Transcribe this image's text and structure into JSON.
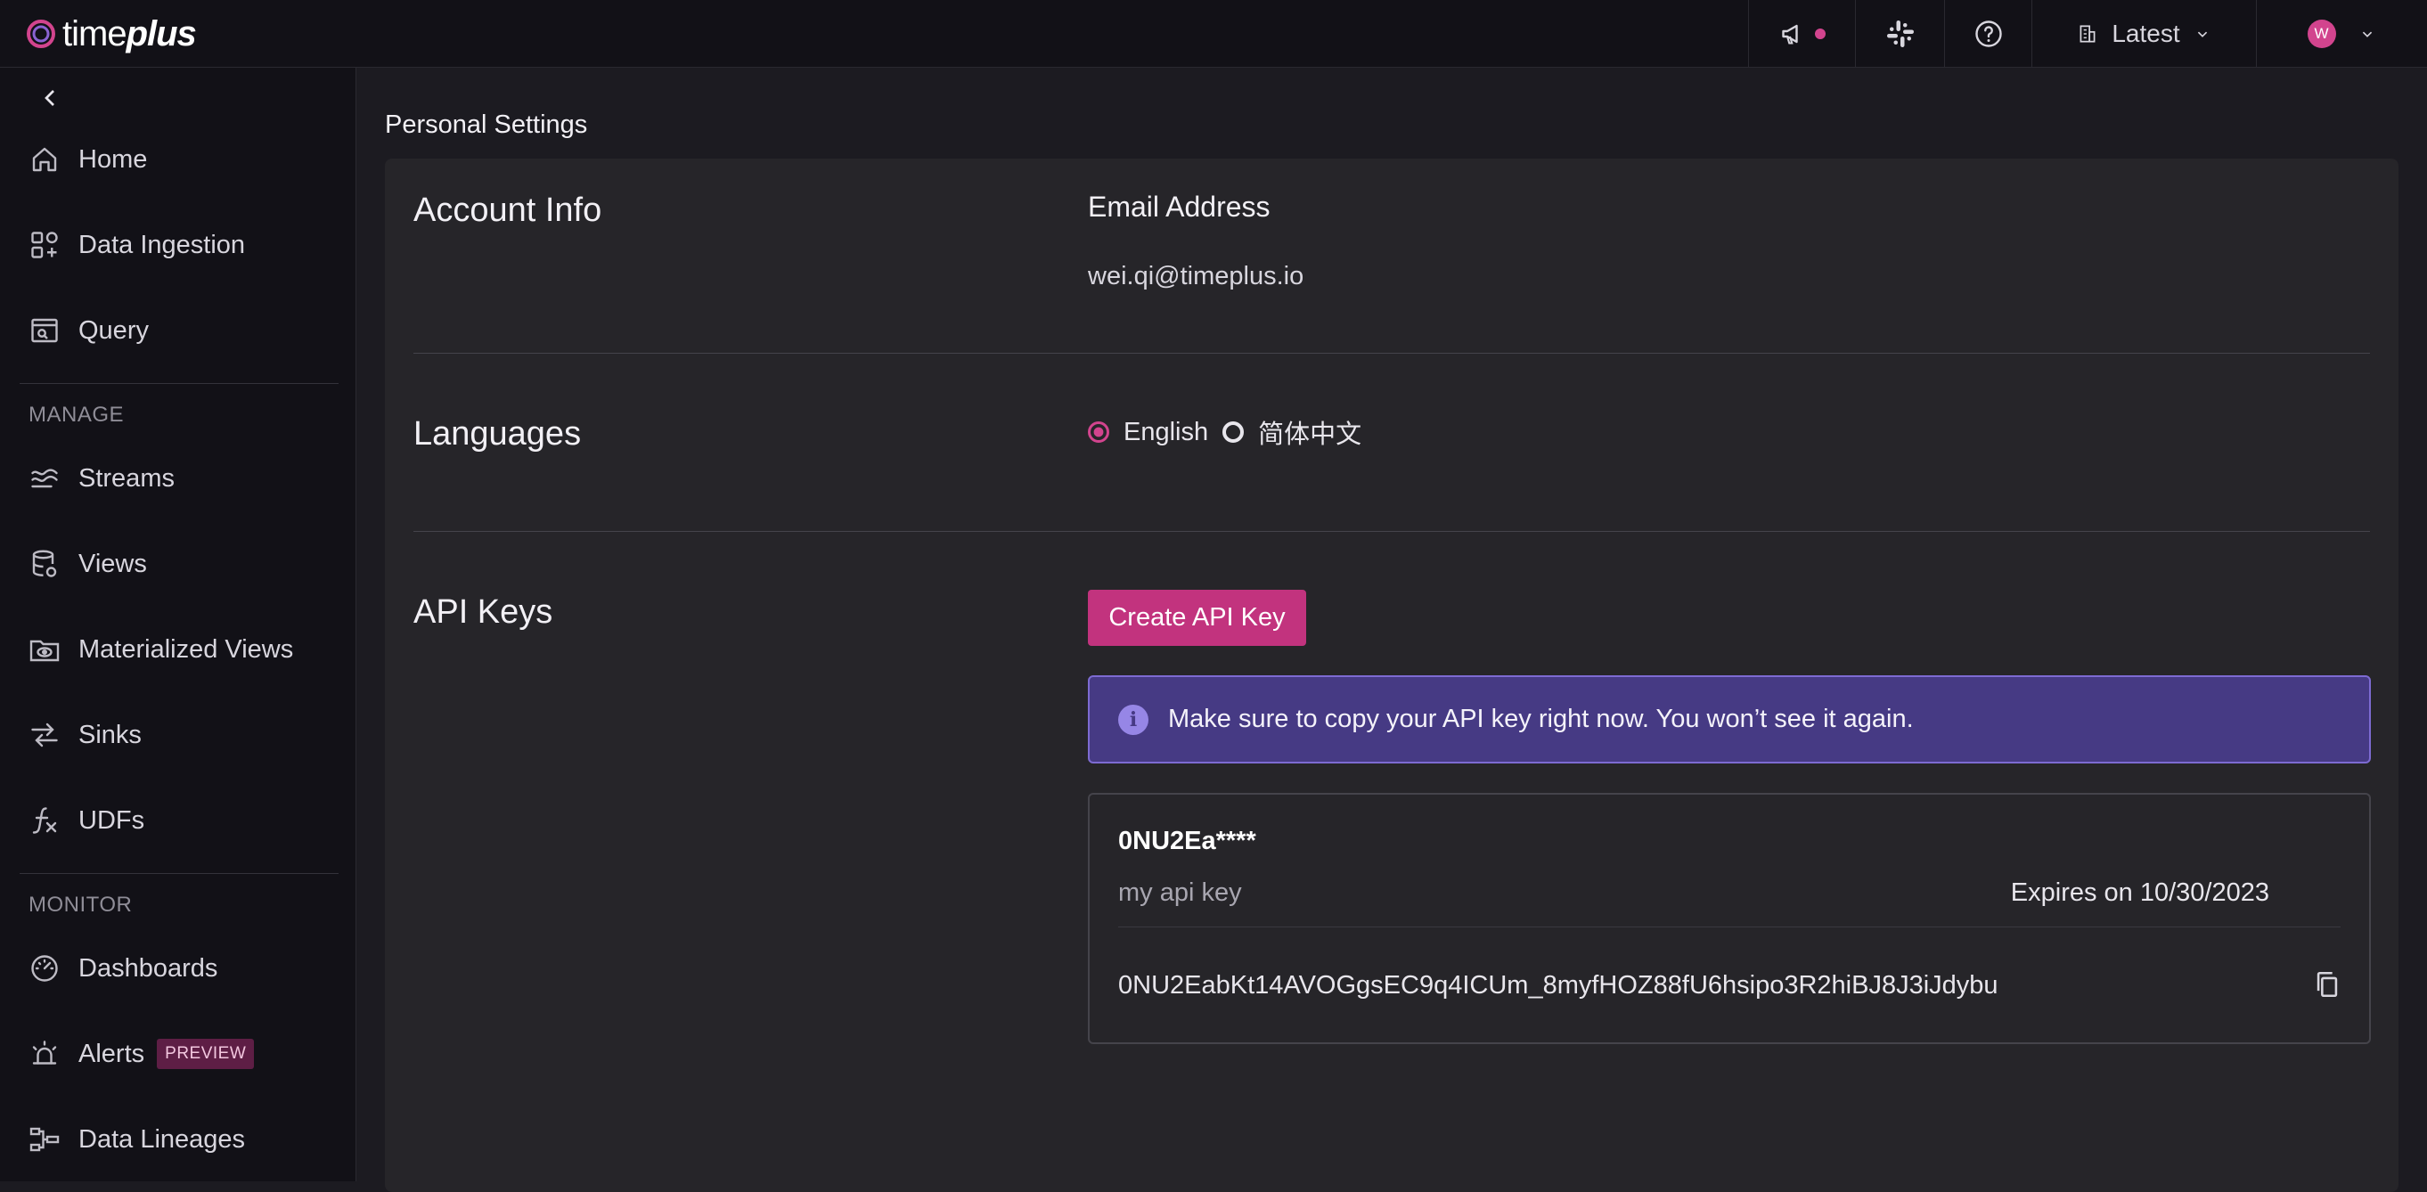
{
  "app": {
    "logo_text_regular": "time",
    "logo_text_bold": "plus"
  },
  "topbar": {
    "announcements_icon": "megaphone-icon",
    "slack_icon": "slack-icon",
    "help_icon": "help-circle-icon",
    "workspace_label": "Latest",
    "avatar_initial": "W",
    "accent": "#d2448e"
  },
  "sidebar": {
    "items_top": [
      {
        "label": "Home",
        "icon": "home-icon"
      },
      {
        "label": "Data Ingestion",
        "icon": "data-ingestion-icon"
      },
      {
        "label": "Query",
        "icon": "query-icon"
      }
    ],
    "manage_heading": "MANAGE",
    "items_manage": [
      {
        "label": "Streams",
        "icon": "streams-icon"
      },
      {
        "label": "Views",
        "icon": "database-icon"
      },
      {
        "label": "Materialized Views",
        "icon": "materialized-view-icon"
      },
      {
        "label": "Sinks",
        "icon": "sinks-icon"
      },
      {
        "label": "UDFs",
        "icon": "function-icon"
      }
    ],
    "monitor_heading": "MONITOR",
    "items_monitor": [
      {
        "label": "Dashboards",
        "icon": "dashboard-icon"
      },
      {
        "label": "Alerts",
        "icon": "alert-siren-icon",
        "badge": "PREVIEW"
      },
      {
        "label": "Data Lineages",
        "icon": "lineage-icon"
      }
    ]
  },
  "main": {
    "page_title": "Personal Settings",
    "account": {
      "title": "Account Info",
      "email_label": "Email Address",
      "email_value": "wei.qi@timeplus.io"
    },
    "languages": {
      "title": "Languages",
      "options": [
        {
          "label": "English",
          "selected": true
        },
        {
          "label": "简体中文",
          "selected": false
        }
      ]
    },
    "api_keys": {
      "title": "API Keys",
      "create_button": "Create API Key",
      "banner_text": "Make sure to copy your API key right now. You won’t see it again.",
      "key": {
        "name": "0NU2Ea****",
        "description": "my api key",
        "expires": "Expires on 10/30/2023",
        "value": "0NU2EabKt14AVOGgsEC9q4ICUm_8myfHOZ88fU6hsipo3R2hiBJ8J3iJdybu"
      }
    }
  }
}
